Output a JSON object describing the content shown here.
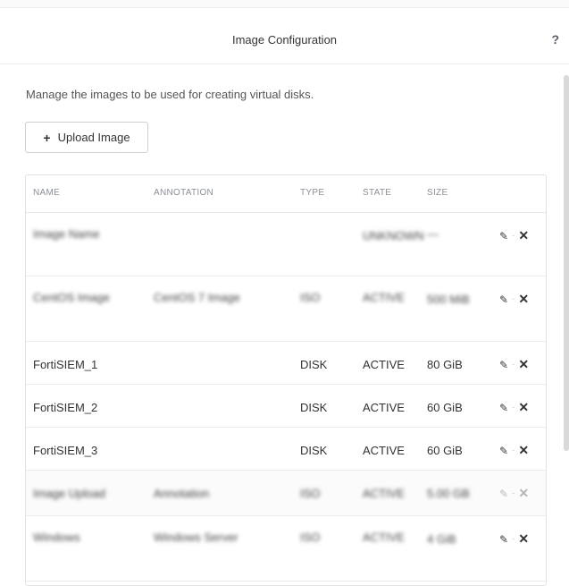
{
  "dialog": {
    "title": "Image Configuration",
    "help_label": "?",
    "description": "Manage the images to be used for creating virtual disks.",
    "upload_button_label": "Upload Image"
  },
  "table": {
    "headers": [
      "NAME",
      "ANNOTATION",
      "TYPE",
      "STATE",
      "SIZE"
    ],
    "rows": [
      {
        "name": "Image Name",
        "annotation": "",
        "type": "",
        "state": "UNKNOWN",
        "size": "—"
      },
      {
        "name": "CentOS Image",
        "annotation": "CentOS 7 Image",
        "type": "ISO",
        "state": "ACTIVE",
        "size": "500 MiB"
      },
      {
        "name": "FortiSIEM_1",
        "annotation": "",
        "type": "DISK",
        "state": "ACTIVE",
        "size": "80 GiB"
      },
      {
        "name": "FortiSIEM_2",
        "annotation": "",
        "type": "DISK",
        "state": "ACTIVE",
        "size": "60 GiB"
      },
      {
        "name": "FortiSIEM_3",
        "annotation": "",
        "type": "DISK",
        "state": "ACTIVE",
        "size": "60 GiB"
      },
      {
        "name": "Image Upload",
        "annotation": "Annotation",
        "type": "ISO",
        "state": "ACTIVE",
        "size": "5.00 GB"
      },
      {
        "name": "Windows",
        "annotation": "Windows Server",
        "type": "ISO",
        "state": "ACTIVE",
        "size": "4 GiB"
      }
    ]
  },
  "icons": {
    "edit": "pencil-icon",
    "delete": "close-icon",
    "upload": "plus-icon",
    "help": "question-icon"
  },
  "colors": {
    "text": "#333333",
    "header_text": "#8a8f96",
    "border": "#e2e2e2"
  }
}
